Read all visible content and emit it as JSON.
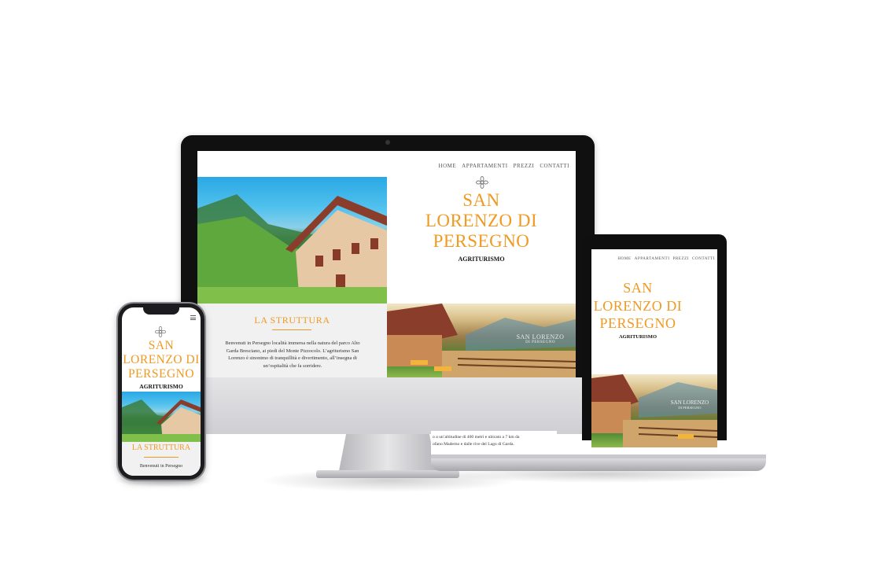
{
  "site": {
    "nav": [
      "HOME",
      "APPARTAMENTI",
      "PREZZI",
      "CONTATTI"
    ],
    "title_lines": [
      "SAN",
      "LORENZO DI",
      "PERSEGNO"
    ],
    "subtitle": "AGRITURISMO",
    "logo_icon": "flower-icon",
    "section_heading": "LA STRUTTURA",
    "intro_paragraph": "Benvenuti in Persegno località immersa nella natura del parco Alto Garda Bresciano, ai piedi del Monte Pizzocolo. L’agriturismo San Lorenzo è sinonimo di tranquillità e divertimento, all’insegna di un’ospitalità che fa sorridere.",
    "watermark_text": "SAN LORENZO",
    "watermark_sub": "DI PERSEGNO",
    "laptop_peek_text": "o a un’altitudine di 400 metri e ubicato a 7 km da\nofano Maderno e dalle rive del Lago di Garda.",
    "phone_intro": "Benvenuti in Persegno",
    "menu_icon": "hamburger-menu-icon"
  },
  "colors": {
    "accent": "#ef9a23",
    "section_bg": "#f1f1f1",
    "device_dark": "#101010"
  }
}
